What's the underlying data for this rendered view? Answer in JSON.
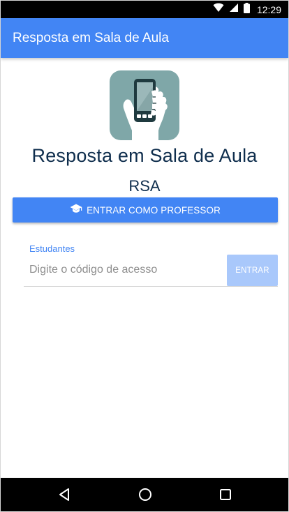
{
  "status_bar": {
    "time": "12:29",
    "icons": [
      "wifi-icon",
      "signal-icon",
      "battery-icon"
    ]
  },
  "app_bar": {
    "title": "Resposta em Sala de Aula",
    "color": "#4285f4"
  },
  "logo": {
    "icon": "hand-holding-phone-icon",
    "background": "#7fa7a8"
  },
  "main": {
    "app_name": "Resposta em Sala de Aula",
    "acronym": "RSA"
  },
  "teacher": {
    "button_label": "ENTRAR COMO PROFESSOR",
    "icon": "graduation-cap-icon"
  },
  "students": {
    "label": "Estudantes",
    "input_placeholder": "Digite o código de acesso",
    "input_value": "",
    "enter_label": "ENTRAR",
    "enter_enabled": false
  },
  "nav_bar": {
    "buttons": [
      "back-icon",
      "home-icon",
      "recents-icon"
    ]
  }
}
